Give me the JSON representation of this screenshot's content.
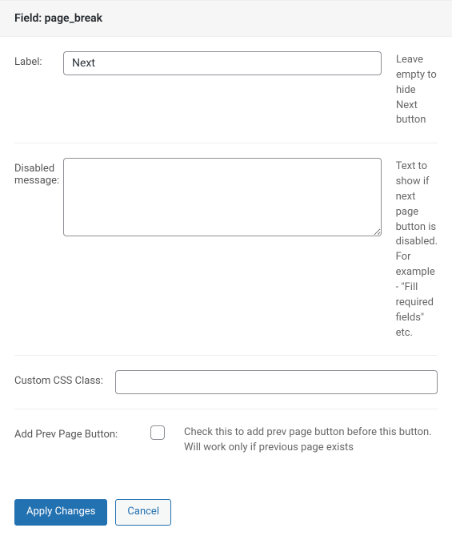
{
  "header": {
    "title": "Field: page_break"
  },
  "fields": {
    "label": {
      "text": "Label:",
      "value": "Next",
      "help": "Leave empty to hide Next button"
    },
    "disabled_message": {
      "text": "Disabled message:",
      "value": "",
      "help": "Text to show if next page button is disabled. For example - \"Fill required fields\" etc."
    },
    "custom_css": {
      "text": "Custom CSS Class:",
      "value": ""
    },
    "add_prev": {
      "text": "Add Prev Page Button:",
      "checked": false,
      "help": "Check this to add prev page button before this button. Will work only if previous page exists"
    }
  },
  "footer": {
    "apply": "Apply Changes",
    "cancel": "Cancel"
  }
}
